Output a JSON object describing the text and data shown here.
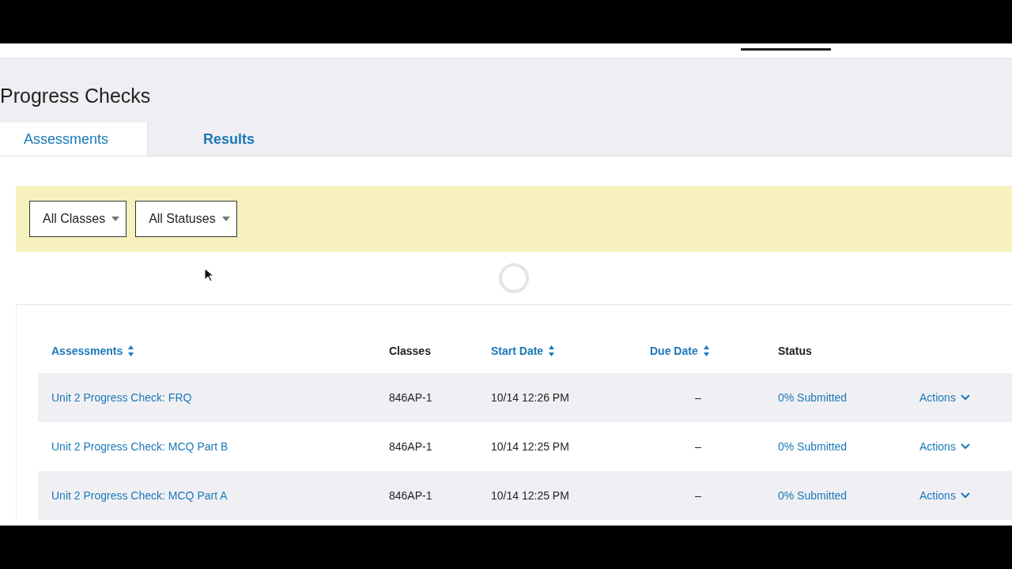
{
  "page_title": "Progress Checks",
  "tabs": [
    {
      "label": "Assessments",
      "selected": true
    },
    {
      "label": "Results",
      "selected": false
    }
  ],
  "filters": [
    {
      "label": "All Classes"
    },
    {
      "label": "All Statuses"
    }
  ],
  "table": {
    "columns": [
      {
        "label": "Assessments",
        "sortable": true
      },
      {
        "label": "Classes",
        "sortable": false
      },
      {
        "label": "Start Date",
        "sortable": true
      },
      {
        "label": "Due Date",
        "sortable": true
      },
      {
        "label": "Status",
        "sortable": false
      }
    ],
    "rows": [
      {
        "assessment": "Unit 2 Progress Check: FRQ",
        "classes": "846AP-1",
        "start_date": "10/14 12:26 PM",
        "due_date": "–",
        "status": "0% Submitted",
        "action": "Actions"
      },
      {
        "assessment": "Unit 2 Progress Check: MCQ Part B",
        "classes": "846AP-1",
        "start_date": "10/14 12:25 PM",
        "due_date": "–",
        "status": "0% Submitted",
        "action": "Actions"
      },
      {
        "assessment": "Unit 2 Progress Check: MCQ Part A",
        "classes": "846AP-1",
        "start_date": "10/14 12:25 PM",
        "due_date": "–",
        "status": "0% Submitted",
        "action": "Actions"
      }
    ]
  }
}
